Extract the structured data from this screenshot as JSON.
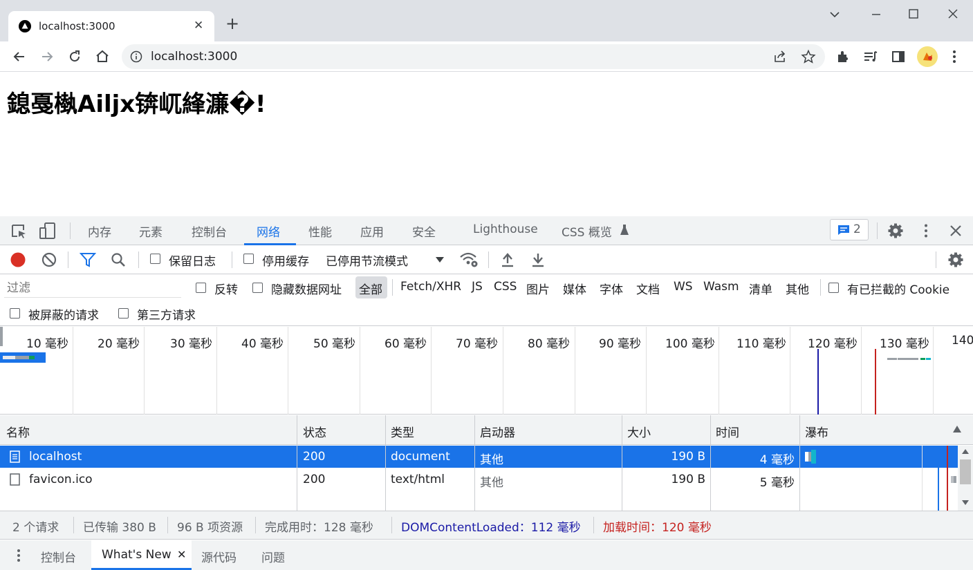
{
  "browser": {
    "tab_title": "localhost:3000",
    "url": "localhost:3000"
  },
  "page": {
    "heading": "鎴戞槸Ailjx锛屼綘濂�!"
  },
  "devtools": {
    "tabs": [
      "内存",
      "元素",
      "控制台",
      "网络",
      "性能",
      "应用",
      "安全",
      "Lighthouse",
      "CSS 概览"
    ],
    "active_tab": "网络",
    "issues_count": "2",
    "toolbar": {
      "preserve_log": "保留日志",
      "disable_cache": "停用缓存",
      "throttling": "已停用节流模式"
    },
    "filter": {
      "placeholder": "过滤",
      "invert": "反转",
      "hide_data_urls": "隐藏数据网址",
      "types": [
        "全部",
        "Fetch/XHR",
        "JS",
        "CSS",
        "图片",
        "媒体",
        "字体",
        "文档",
        "WS",
        "Wasm",
        "清单",
        "其他"
      ],
      "blocked_cookies": "有已拦截的 Cookie",
      "blocked_requests": "被屏蔽的请求",
      "third_party": "第三方请求"
    },
    "overview_ticks": [
      "10 毫秒",
      "20 毫秒",
      "30 毫秒",
      "40 毫秒",
      "50 毫秒",
      "60 毫秒",
      "70 毫秒",
      "80 毫秒",
      "90 毫秒",
      "100 毫秒",
      "110 毫秒",
      "120 毫秒",
      "130 毫秒",
      "140"
    ],
    "columns": [
      "名称",
      "状态",
      "类型",
      "启动器",
      "大小",
      "时间",
      "瀑布"
    ],
    "rows": [
      {
        "name": "localhost",
        "status": "200",
        "type": "document",
        "initiator": "其他",
        "size": "190 B",
        "time": "4 毫秒"
      },
      {
        "name": "favicon.ico",
        "status": "200",
        "type": "text/html",
        "initiator": "其他",
        "size": "190 B",
        "time": "5 毫秒"
      }
    ],
    "status_bar": {
      "requests": "2 个请求",
      "transferred": "已传输 380 B",
      "resources": "96 B 项资源",
      "finish": "完成用时：128 毫秒",
      "dcl": "DOMContentLoaded：112 毫秒",
      "load": "加载时间：120 毫秒"
    },
    "drawer_tabs": [
      "控制台",
      "What's New",
      "源代码",
      "问题"
    ],
    "colors": {
      "accent": "#1a73e8",
      "record": "#d93025",
      "dcl": "#1a1aa6",
      "load": "#c5221f"
    }
  }
}
